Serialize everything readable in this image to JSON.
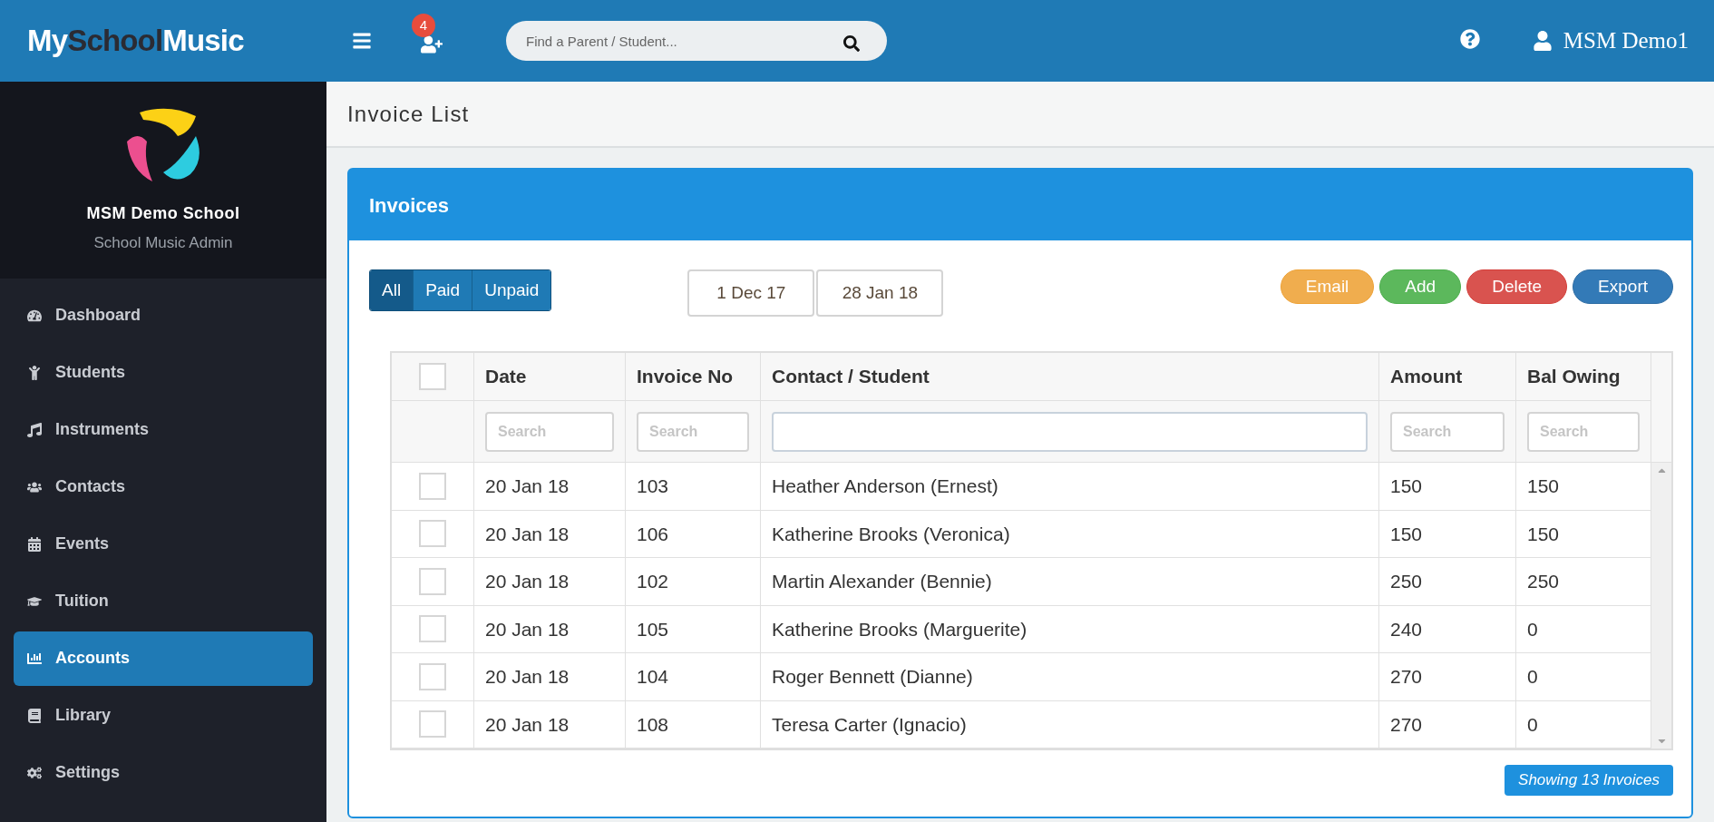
{
  "topbar": {
    "logo": [
      "My",
      "School",
      "Music"
    ],
    "notification_count": "4",
    "search": {
      "placeholder": "Find a Parent / Student..."
    },
    "user": "MSM Demo1"
  },
  "school": {
    "name": "MSM Demo School",
    "subtitle": "School Music Admin"
  },
  "sidebar": {
    "items": [
      {
        "label": "Dashboard",
        "selected": false
      },
      {
        "label": "Students",
        "selected": false
      },
      {
        "label": "Instruments",
        "selected": false
      },
      {
        "label": "Contacts",
        "selected": false
      },
      {
        "label": "Events",
        "selected": false
      },
      {
        "label": "Tuition",
        "selected": false
      },
      {
        "label": "Accounts",
        "selected": true
      },
      {
        "label": "Library",
        "selected": false
      },
      {
        "label": "Settings",
        "selected": false
      }
    ]
  },
  "page_title": "Invoice List",
  "card": {
    "title": "Invoices",
    "filters": [
      {
        "label": "All",
        "selected": true
      },
      {
        "label": "Paid",
        "selected": false
      },
      {
        "label": "Unpaid",
        "selected": false
      }
    ],
    "date_range": [
      "1 Dec 17",
      "28 Jan 18"
    ],
    "actions": [
      {
        "label": "Email",
        "kind": "warning"
      },
      {
        "label": "Add",
        "kind": "success"
      },
      {
        "label": "Delete",
        "kind": "danger"
      },
      {
        "label": "Export",
        "kind": "primary"
      }
    ],
    "table": {
      "select_all_checked": false,
      "columns": [
        {
          "label": "Date",
          "search_placeholder": "Search"
        },
        {
          "label": "Invoice No",
          "search_placeholder": "Search"
        },
        {
          "label": "Contact / Student"
        },
        {
          "label": "Amount",
          "search_placeholder": "Search"
        },
        {
          "label": "Bal Owing",
          "search_placeholder": "Search"
        }
      ],
      "rows": [
        {
          "checked": false,
          "cells": [
            "20 Jan 18",
            "103",
            "Heather Anderson (Ernest)",
            "150",
            "150"
          ]
        },
        {
          "checked": false,
          "cells": [
            "20 Jan 18",
            "106",
            "Katherine Brooks (Veronica)",
            "150",
            "150"
          ]
        },
        {
          "checked": false,
          "cells": [
            "20 Jan 18",
            "102",
            "Martin Alexander (Bennie)",
            "250",
            "250"
          ]
        },
        {
          "checked": false,
          "cells": [
            "20 Jan 18",
            "105",
            "Katherine Brooks (Marguerite)",
            "240",
            "0"
          ]
        },
        {
          "checked": false,
          "cells": [
            "20 Jan 18",
            "104",
            "Roger Bennett (Dianne)",
            "270",
            "0"
          ]
        },
        {
          "checked": false,
          "cells": [
            "20 Jan 18",
            "108",
            "Teresa Carter (Ignacio)",
            "270",
            "0"
          ]
        }
      ]
    },
    "footer_badge": "Showing 13 Invoices"
  }
}
